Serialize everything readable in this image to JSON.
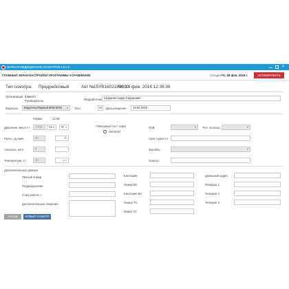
{
  "titlebar": {
    "title": "ЖУРНАЛ МЕДИЦИНСКИХ ОСМОТРОВ 3.0.0.0",
    "close_glyph": "×"
  },
  "menu": {
    "items": [
      "ГЛАВНЫЙ ЭКРАН",
      "НАСТРОЙКИ ПРОГРАММЫ ▾",
      "СРАВНЕНИЕ"
    ],
    "today_label": "Сегодня:",
    "today_value": "Чт, 18 фев. 2016 г.",
    "activate_label": "АКТИВИРОВАТЬ"
  },
  "header": {
    "exam_type_label": "Тип осмотра:",
    "exam_type_value": "Предрейсовый",
    "act_label": "Акт №",
    "act_number": "15УВ1602180000",
    "act_datetime": "Чт, 18 фев. 2016 12:36:36"
  },
  "organization": {
    "label": "Организация",
    "client": "Клиент1",
    "managers_label": "Руководитель:",
    "medic_label": "Медработник",
    "medic_value": "Сидоров Сидор Сидорович"
  },
  "driver": {
    "label": "Водитель",
    "value": "Водитель!Первый ВПИ ВПО",
    "sex_label": "Пол",
    "sex_value": "М",
    "birth_label": "Дата рождения",
    "birth_value": "19.02.2016"
  },
  "vitals": {
    "norm_label": "Норма",
    "time_value": "12:36",
    "pressure_label": "Давление, мм.рт.ст",
    "pressure_norm": "1/100",
    "pressure_sys": "Ск",
    "pressure_dia": "Кт",
    "pulse_label": "Пульс, уд./мин",
    "pulse_norm": "60",
    "alcohol_label": "Алкоголь, мг/л",
    "alcohol_norm": "0",
    "temp_label": "Температура, С°",
    "temp_norm": "36",
    "temp_unit": "м.к",
    "retest_label": "Повторный тест через",
    "retest_time": "00:19:57",
    "pav_label": "ПАВ",
    "test_strip_label": "Тест полоска",
    "expiry_label": "Срок годности",
    "complaints_label": "Жалобы",
    "remark_label": "Осмотр:"
  },
  "extra": {
    "section_title": "Дополнительные данные",
    "col1": [
      "Личный номер",
      "Подразделение",
      "Стаж работы с",
      "Дополнительные сведения"
    ],
    "col2": [
      "Категория",
      "Номер ВУ",
      "Категория ВУ",
      "Номер ТС",
      "Марка ТС"
    ],
    "col3": [
      "Домашний адрес",
      "Телефон 1",
      "Телефон 2",
      "Телефон 3"
    ]
  },
  "buttons": {
    "back": "НАЗАД",
    "new_exam": "НОВЫЙ ОСМОТР"
  },
  "colors": {
    "titlebar": "#1e9bd7",
    "activate": "#c8333a",
    "primary": "#3f6ea3",
    "secondary": "#9ea3a8"
  }
}
